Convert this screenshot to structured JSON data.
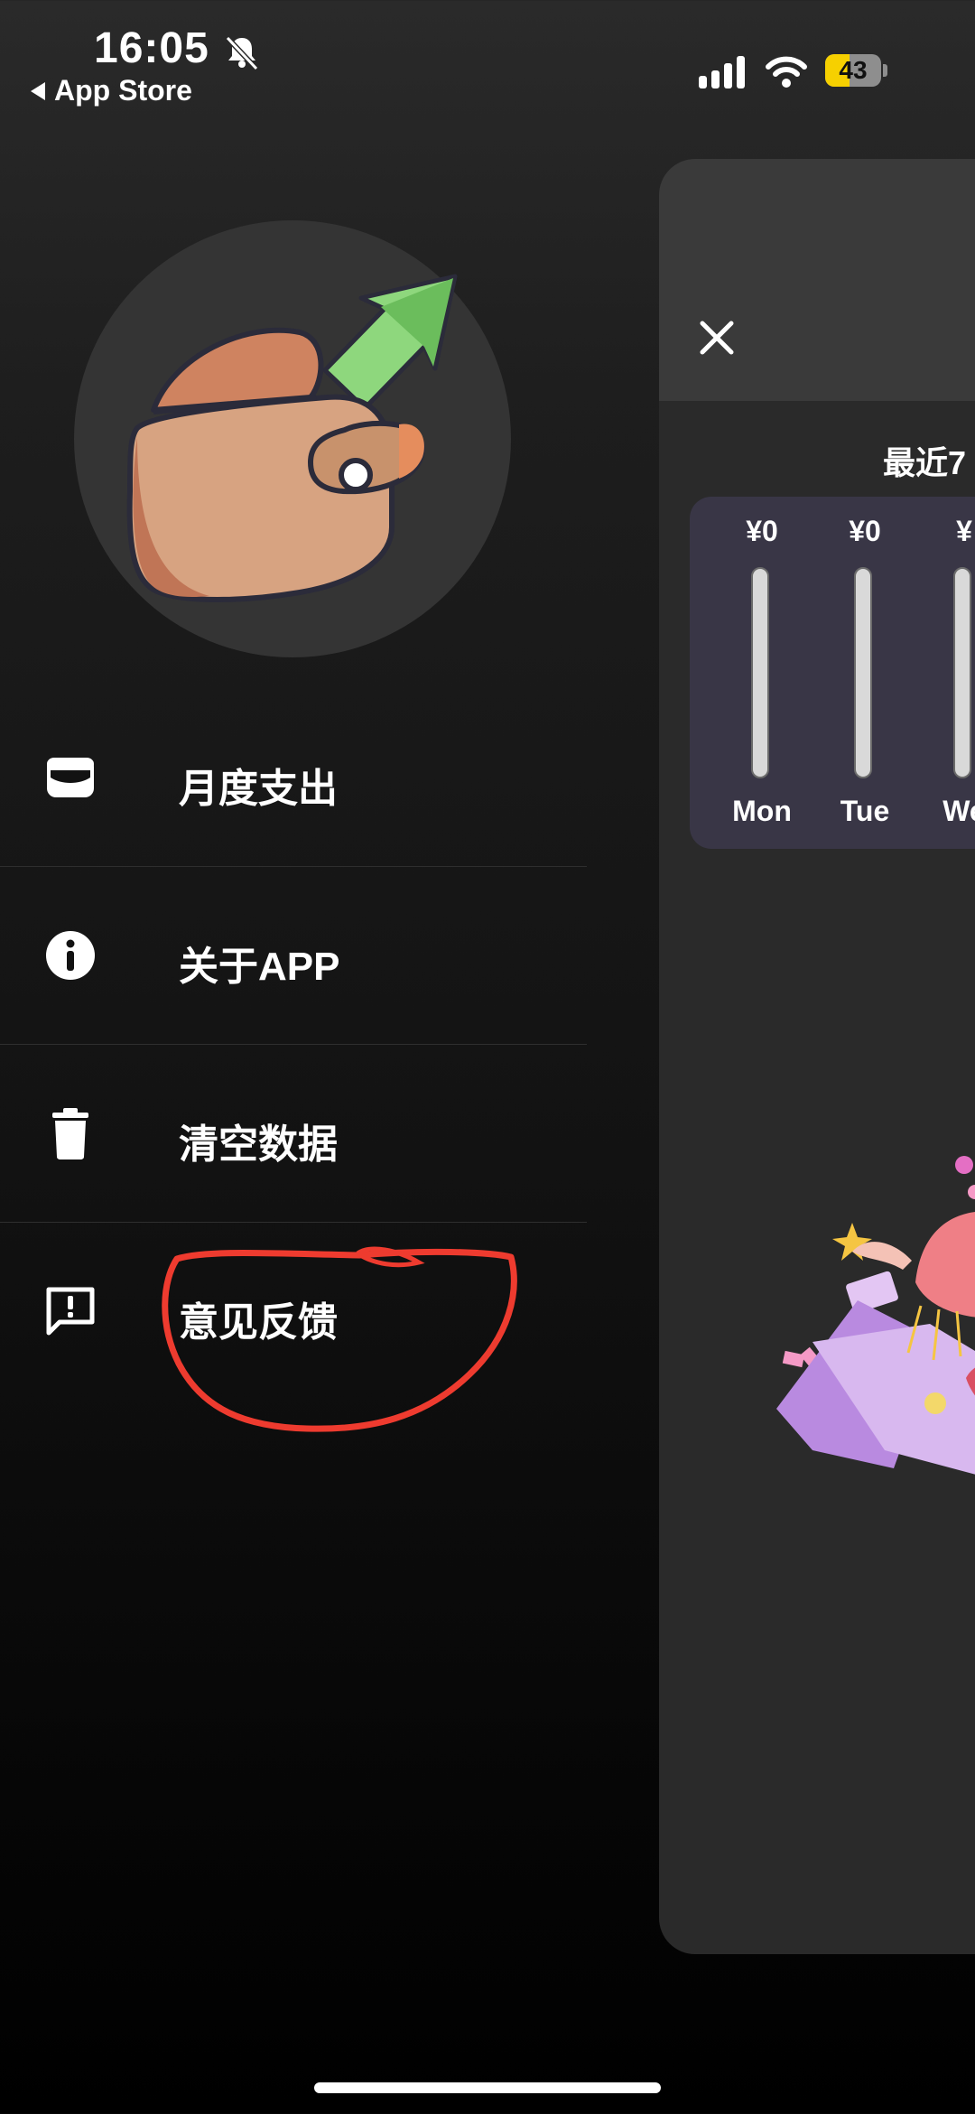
{
  "status_bar": {
    "time": "16:05",
    "back_label": "App Store",
    "battery_level": "43",
    "battery_fraction": 0.43,
    "icons": [
      "bell-slash-icon",
      "cellular-signal-icon",
      "wifi-icon",
      "battery-icon"
    ]
  },
  "menu": {
    "items": [
      {
        "label": "月度支出",
        "icon": "wallet-icon"
      },
      {
        "label": "关于APP",
        "icon": "info-icon"
      },
      {
        "label": "清空数据",
        "icon": "trash-icon"
      },
      {
        "label": "意见反馈",
        "icon": "feedback-icon"
      }
    ]
  },
  "panel": {
    "title": "最近7",
    "close_icon": "close-icon",
    "days": [
      {
        "name": "Mon",
        "amount": "¥0"
      },
      {
        "name": "Tue",
        "amount": "¥0"
      },
      {
        "name": "We",
        "amount": "¥"
      }
    ]
  },
  "colors": {
    "accent_annotation": "#ee3b2f",
    "battery_yellow": "#f6d000",
    "card_bg": "#393646"
  }
}
